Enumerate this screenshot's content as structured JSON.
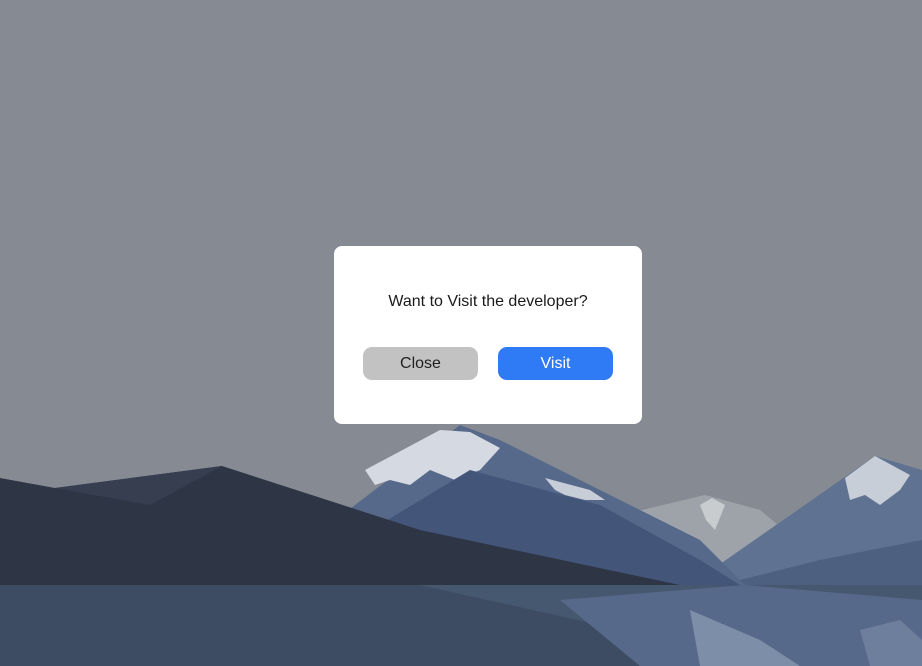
{
  "dialog": {
    "message": "Want to Visit the developer?",
    "close_label": "Close",
    "visit_label": "Visit"
  },
  "colors": {
    "backdrop": "#868b93",
    "dialog_background": "#ffffff",
    "close_button": "#c2c2c2",
    "visit_button": "#2f7af5"
  }
}
